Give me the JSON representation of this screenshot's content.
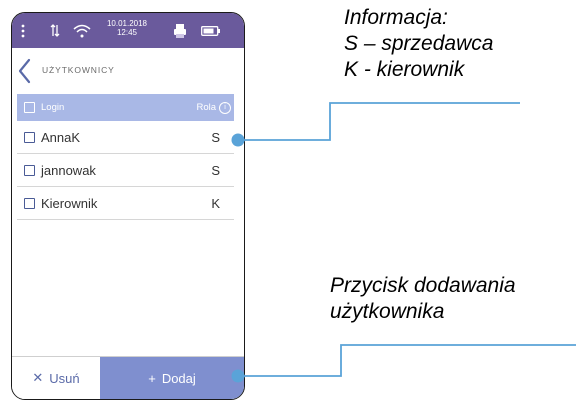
{
  "colors": {
    "statusbar": "#6a5a9c",
    "accent": "#7f8fcf",
    "header_row": "#a9b8e6",
    "leader_line": "#5aa3d8"
  },
  "statusbar": {
    "date": "10.01.2018",
    "time": "12:45",
    "icons": [
      "menu-dots-icon",
      "data-transfer-icon",
      "wifi-icon",
      "printer-icon",
      "battery-icon"
    ]
  },
  "header": {
    "title": "UŻYTKOWNICY"
  },
  "table": {
    "columns": {
      "login": "Login",
      "role": "Rola"
    },
    "rows": [
      {
        "login": "AnnaK",
        "role": "S"
      },
      {
        "login": "jannowak",
        "role": "S"
      },
      {
        "login": "Kierownik",
        "role": "K"
      }
    ]
  },
  "footer": {
    "delete_label": "Usuń",
    "add_label": "Dodaj"
  },
  "callouts": {
    "info": [
      "Informacja:",
      "S – sprzedawca",
      "K - kierownik"
    ],
    "add": [
      "Przycisk dodawania",
      "użytkownika"
    ]
  }
}
